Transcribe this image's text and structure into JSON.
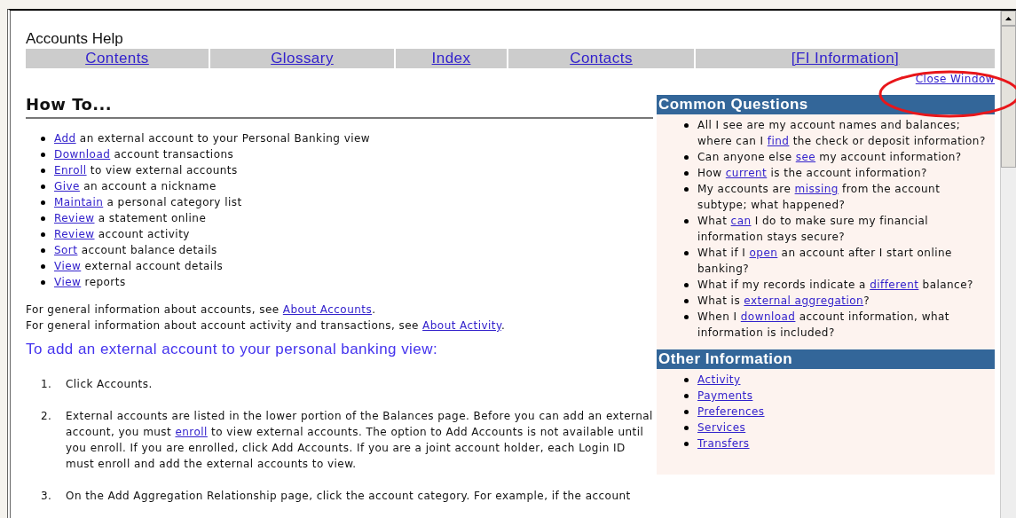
{
  "title": "Accounts Help",
  "nav": [
    {
      "label": "Contents"
    },
    {
      "label": "Glossary"
    },
    {
      "label": "Index"
    },
    {
      "label": "Contacts"
    },
    {
      "label": "[FI Information]"
    }
  ],
  "close_link": "Close Window",
  "how_to": {
    "heading": "How To...",
    "items": [
      {
        "link": "Add",
        "text": " an external account to your Personal Banking view"
      },
      {
        "link": "Download",
        "text": " account transactions"
      },
      {
        "link": "Enroll",
        "text": " to view external accounts"
      },
      {
        "link": "Give",
        "text": " an account a nickname"
      },
      {
        "link": "Maintain",
        "text": " a personal category list"
      },
      {
        "link": "Review",
        "text": " a statement online"
      },
      {
        "link": "Review",
        "text": " account activity"
      },
      {
        "link": "Sort",
        "text": " account balance details"
      },
      {
        "link": "View",
        "text": " external account details"
      },
      {
        "link": "View",
        "text": " reports"
      }
    ],
    "notes": [
      {
        "before": "For general information about accounts, see ",
        "link": "About Accounts",
        "after": "."
      },
      {
        "before": "For general information about account activity and transactions, see ",
        "link": "About Activity",
        "after": "."
      }
    ],
    "section_title": "To add an external account to your personal banking view:",
    "steps": [
      {
        "number": "1.",
        "before": "Click Accounts."
      },
      {
        "number": "2.",
        "before": "External accounts are listed in the lower portion of the Balances page. Before you can add an external account, you must ",
        "link": "enroll",
        "after": " to view external accounts. The option to Add Accounts is not available until you enroll. If you are enrolled, click Add Accounts. If you are a joint account holder, each Login ID must enroll and add the external accounts to view."
      },
      {
        "number": "3.",
        "before": "On the Add Aggregation Relationship page, click the account category. For example, if the account"
      }
    ]
  },
  "common_questions": {
    "heading": "Common Questions",
    "items": [
      {
        "before": "All I see are my account names and balances; where can I ",
        "link": "find",
        "after": " the check or deposit information?"
      },
      {
        "before": "Can anyone else ",
        "link": "see",
        "after": " my account information?"
      },
      {
        "before": "How ",
        "link": "current",
        "after": " is the account information?"
      },
      {
        "before": "My accounts are ",
        "link": "missing",
        "after": " from the account subtype; what happened?"
      },
      {
        "before": "What ",
        "link": "can",
        "after": " I do to make sure my financial information stays secure?"
      },
      {
        "before": "What if I ",
        "link": "open",
        "after": " an account after I start online banking?"
      },
      {
        "before": "What if my records indicate a ",
        "link": "different",
        "after": " balance?"
      },
      {
        "before": "What is ",
        "link": "external aggregation",
        "after": "?"
      },
      {
        "before": "When I ",
        "link": "download",
        "after": " account information, what information is included?"
      }
    ]
  },
  "other_information": {
    "heading": "Other Information",
    "items": [
      "Activity",
      "Payments",
      "Preferences",
      "Services",
      "Transfers"
    ]
  }
}
